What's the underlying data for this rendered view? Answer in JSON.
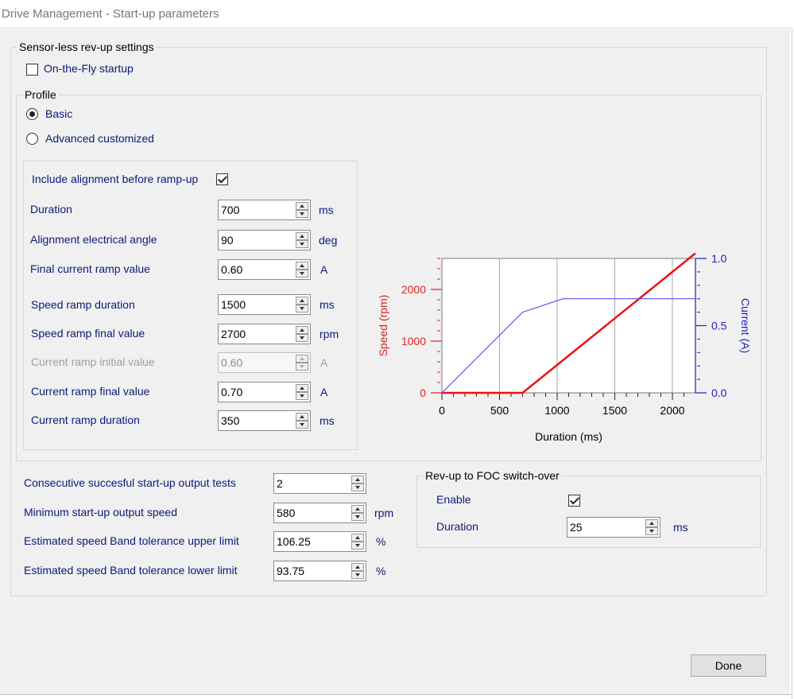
{
  "window": {
    "title": "Drive Management - Start-up parameters"
  },
  "sensorless": {
    "legend": "Sensor-less rev-up settings",
    "on_the_fly": {
      "label": "On-the-Fly startup",
      "checked": false
    },
    "profile": {
      "legend": "Profile",
      "basic": {
        "label": "Basic",
        "selected": true
      },
      "advanced": {
        "label": "Advanced customized",
        "selected": false
      }
    },
    "include_alignment": {
      "label": "Include alignment before ramp-up",
      "checked": true
    },
    "params": [
      {
        "label": "Duration",
        "value": "700",
        "unit": "ms",
        "enabled": true
      },
      {
        "label": "Alignment electrical angle",
        "value": "90",
        "unit": "deg",
        "enabled": true
      },
      {
        "label": "Final current ramp value",
        "value": "0.60",
        "unit": "A",
        "enabled": true
      },
      {
        "label": "Speed ramp duration",
        "value": "1500",
        "unit": "ms",
        "enabled": true
      },
      {
        "label": "Speed ramp final value",
        "value": "2700",
        "unit": "rpm",
        "enabled": true
      },
      {
        "label": "Current ramp initial value",
        "value": "0.60",
        "unit": "A",
        "enabled": false
      },
      {
        "label": "Current ramp final value",
        "value": "0.70",
        "unit": "A",
        "enabled": true
      },
      {
        "label": "Current ramp duration",
        "value": "350",
        "unit": "ms",
        "enabled": true
      }
    ],
    "tests": [
      {
        "label": "Consecutive succesful start-up output tests",
        "value": "2",
        "unit": ""
      },
      {
        "label": "Minimum start-up output speed",
        "value": "580",
        "unit": "rpm"
      },
      {
        "label": "Estimated speed Band tolerance upper limit",
        "value": "106.25",
        "unit": "%"
      },
      {
        "label": "Estimated speed Band tolerance lower limit",
        "value": "93.75",
        "unit": "%"
      }
    ],
    "switchover": {
      "legend": "Rev-up to FOC switch-over",
      "enable": {
        "label": "Enable",
        "checked": true
      },
      "duration": {
        "label": "Duration",
        "value": "25",
        "unit": "ms"
      }
    }
  },
  "chart_data": {
    "type": "line",
    "xlabel": "Duration (ms)",
    "ylabel_left": "Speed (rpm)",
    "ylabel_right": "Current (A)",
    "x_ticks": [
      0,
      500,
      1000,
      1500,
      2000
    ],
    "left_ticks": [
      0,
      1000,
      2000
    ],
    "right_ticks": [
      "0.0",
      "0.5",
      "1.0"
    ],
    "xlim": [
      0,
      2200
    ],
    "ylim_left": [
      0,
      2600
    ],
    "ylim_right": [
      0,
      1.0
    ],
    "vertical_gridlines": [
      500,
      1000,
      1500,
      2000
    ],
    "left_color": "#e02020",
    "right_color": "#2222b0",
    "series": [
      {
        "axis": "left",
        "color": "#ee1111",
        "x": [
          0,
          700,
          2200
        ],
        "y": [
          0,
          0,
          2700
        ]
      },
      {
        "axis": "right",
        "color": "#5555ee",
        "x": [
          0,
          700,
          1050,
          2200
        ],
        "y": [
          0,
          0.6,
          0.7,
          0.7
        ]
      }
    ]
  },
  "footer": {
    "done_label": "Done"
  }
}
